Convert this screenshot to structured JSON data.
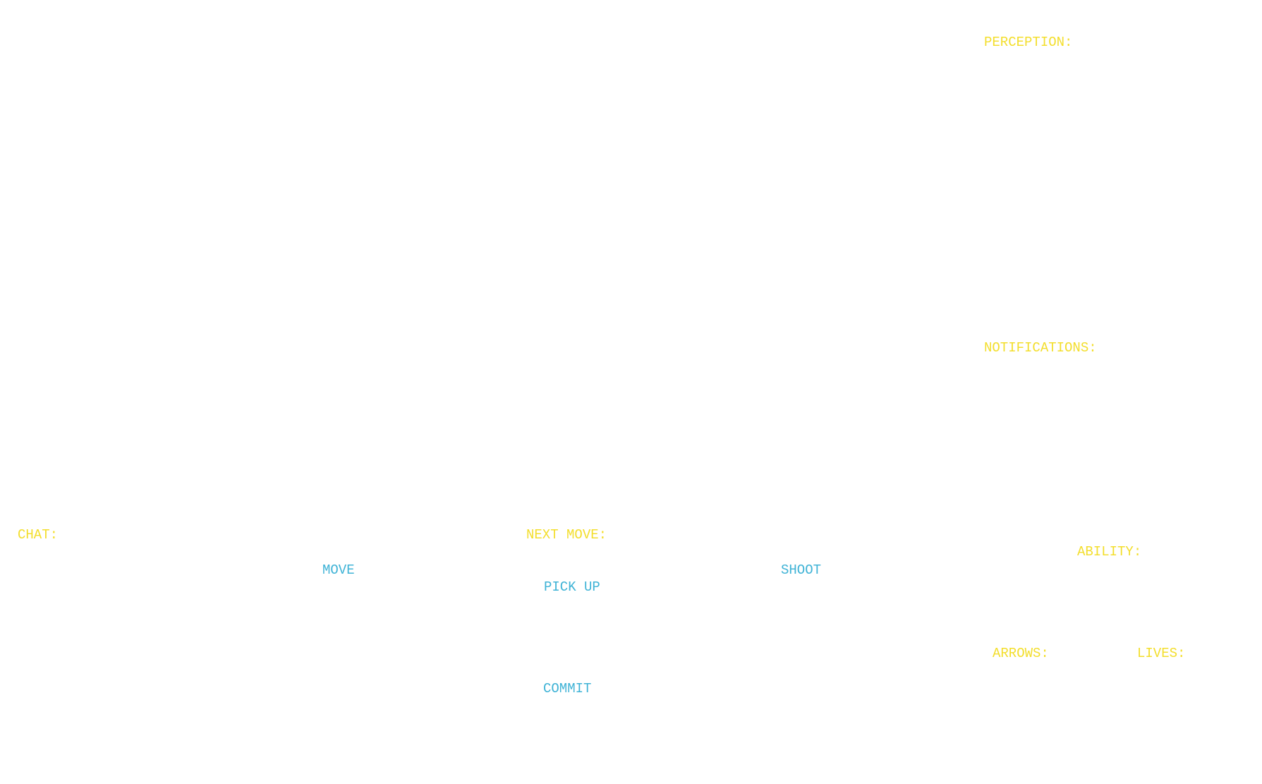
{
  "labels": {
    "perception": "PERCEPTION:",
    "notifications": "NOTIFICATIONS:",
    "chat": "CHAT:",
    "next_move": "NEXT MOVE:",
    "ability": "ABILITY:",
    "arrows": "ARROWS:",
    "lives": "LIVES:"
  },
  "buttons": {
    "move": "MOVE",
    "pick_up": "PICK UP",
    "shoot": "SHOOT",
    "commit": "COMMIT"
  },
  "colors": {
    "label": "#f3de2c",
    "button": "#3fb3d6",
    "background": "#ffffff"
  }
}
